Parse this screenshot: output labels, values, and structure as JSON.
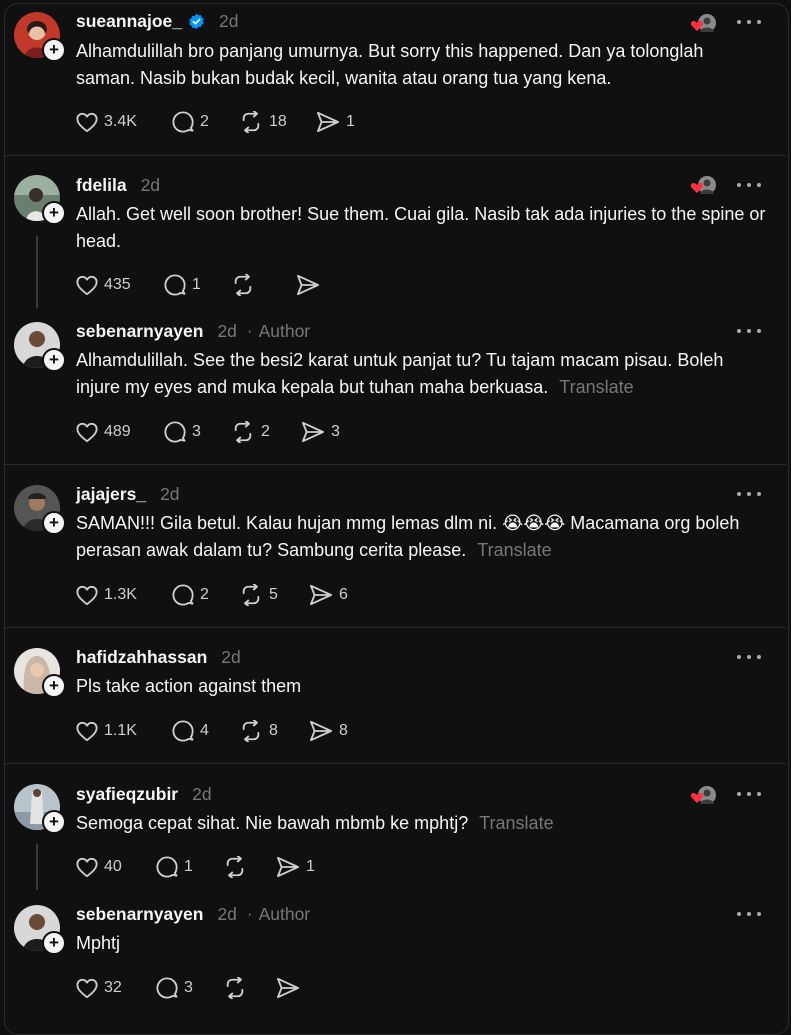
{
  "posts": [
    {
      "username": "sueannajoe_",
      "time": "2d",
      "verified": true,
      "author": "",
      "text": "Alhamdulillah bro panjang umurnya. But sorry this happened. Dan ya tolonglah saman. Nasib bukan budak kecil, wanita atau orang tua yang kena.",
      "translate": "",
      "likes": "3.4K",
      "replies": "2",
      "reposts": "18",
      "shares": "1",
      "liked_by_op": true
    },
    {
      "username": "fdelila",
      "time": "2d",
      "verified": false,
      "author": "",
      "text": "Allah. Get well soon brother! Sue them. Cuai gila. Nasib tak ada injuries to the spine or head.",
      "translate": "",
      "likes": "435",
      "replies": "1",
      "reposts": "",
      "shares": "",
      "liked_by_op": true
    },
    {
      "username": "sebenarnyayen",
      "time": "2d",
      "verified": false,
      "author": "Author",
      "text": "Alhamdulillah. See the besi2 karat untuk panjat tu? Tu tajam macam pisau. Boleh injure my eyes and muka kepala but tuhan maha berkuasa.",
      "translate": "Translate",
      "likes": "489",
      "replies": "3",
      "reposts": "2",
      "shares": "3",
      "liked_by_op": false
    },
    {
      "username": "jajajers_",
      "time": "2d",
      "verified": false,
      "author": "",
      "text": "SAMAN!!! Gila betul. Kalau hujan mmg lemas dlm ni. 😭😭😭 Macamana org boleh perasan awak dalam tu? Sambung cerita please.",
      "translate": "Translate",
      "likes": "1.3K",
      "replies": "2",
      "reposts": "5",
      "shares": "6",
      "liked_by_op": false
    },
    {
      "username": "hafidzahhassan",
      "time": "2d",
      "verified": false,
      "author": "",
      "text": "Pls take action against them",
      "translate": "",
      "likes": "1.1K",
      "replies": "4",
      "reposts": "8",
      "shares": "8",
      "liked_by_op": false
    },
    {
      "username": "syafieqzubir",
      "time": "2d",
      "verified": false,
      "author": "",
      "text": "Semoga cepat sihat. Nie bawah mbmb ke mphtj?",
      "translate": "Translate",
      "likes": "40",
      "replies": "1",
      "reposts": "",
      "shares": "1",
      "liked_by_op": true
    },
    {
      "username": "sebenarnyayen",
      "time": "2d",
      "verified": false,
      "author": "Author",
      "text": "Mphtj",
      "translate": "",
      "likes": "32",
      "replies": "3",
      "reposts": "",
      "shares": "",
      "liked_by_op": false
    }
  ],
  "labels": {
    "plus": "+",
    "dot": "·"
  },
  "colors": {
    "background": "#101010",
    "text": "#f3f5f7",
    "muted": "#777777",
    "verified": "#0095f6",
    "heart": "#ff3040"
  }
}
